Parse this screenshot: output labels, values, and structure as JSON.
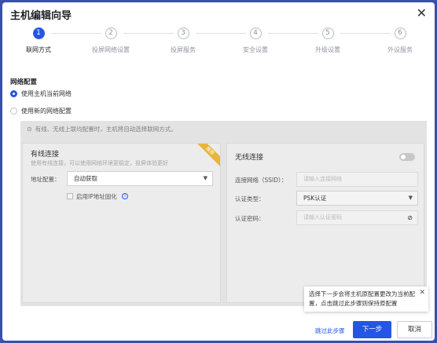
{
  "dialog": {
    "title": "主机编辑向导",
    "close_icon": "close-icon"
  },
  "steps": [
    {
      "num": "1",
      "label": "联网方式",
      "active": true
    },
    {
      "num": "2",
      "label": "投屏网络设置",
      "active": false
    },
    {
      "num": "3",
      "label": "投屏服务",
      "active": false
    },
    {
      "num": "4",
      "label": "安全设置",
      "active": false
    },
    {
      "num": "5",
      "label": "升级设置",
      "active": false
    },
    {
      "num": "6",
      "label": "外设服务",
      "active": false
    }
  ],
  "network": {
    "section_title": "网络配置",
    "option_current": "使用主机当前网络",
    "option_new": "使用新的网络配置",
    "selected": "option_current"
  },
  "panel": {
    "hint": "有线、无线上联均配置时，主机将自动选择联网方式。",
    "wired": {
      "title": "有线连接",
      "subtitle": "使用有线连接，可以使用网络环境更稳定，投屏体验更好",
      "badge": "推荐",
      "addr_label": "地址配置：",
      "addr_value": "自动获取",
      "static_ip_label": "启用IP地址固化"
    },
    "wifi": {
      "title": "无线连接",
      "ssid_label": "连接网络（SSID）：",
      "ssid_placeholder": "请输入连接网络",
      "auth_type_label": "认证类型：",
      "auth_type_value": "PSK认证",
      "auth_pwd_label": "认证密码：",
      "auth_pwd_placeholder": "请输入认证密码",
      "enabled": false
    }
  },
  "tooltip": {
    "line1": "选择下一步会将主机原配置更改为当前配",
    "line2": "置，点击跳过此步骤则保持原配置"
  },
  "footer": {
    "skip": "跳过此步骤",
    "next": "下一步",
    "cancel": "取消"
  },
  "colors": {
    "accent": "#2456e6",
    "badge": "#e9b53b"
  }
}
